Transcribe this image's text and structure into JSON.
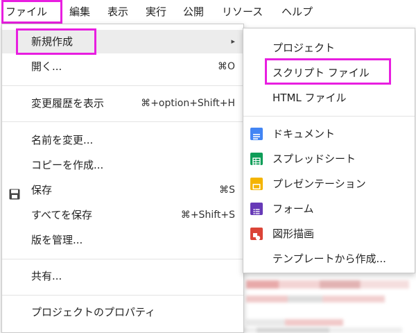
{
  "menubar": {
    "items": [
      "ファイル",
      "編集",
      "表示",
      "実行",
      "公開",
      "リソース",
      "ヘルプ"
    ]
  },
  "file_menu": {
    "items": [
      {
        "label": "新規作成",
        "shortcut": "▸"
      },
      {
        "label": "開く...",
        "shortcut": "⌘O"
      },
      {
        "label": "変更履歴を表示",
        "shortcut": "⌘+option+Shift+H"
      },
      {
        "label": "名前を変更...",
        "shortcut": ""
      },
      {
        "label": "コピーを作成...",
        "shortcut": ""
      },
      {
        "label": "保存",
        "shortcut": "⌘S"
      },
      {
        "label": "すべてを保存",
        "shortcut": "⌘+Shift+S"
      },
      {
        "label": "版を管理...",
        "shortcut": ""
      },
      {
        "label": "共有...",
        "shortcut": ""
      },
      {
        "label": "プロジェクトのプロパティ",
        "shortcut": ""
      }
    ]
  },
  "new_submenu": {
    "items": [
      {
        "label": "プロジェクト",
        "icon": "none"
      },
      {
        "label": "スクリプト ファイル",
        "icon": "none"
      },
      {
        "label": "HTML ファイル",
        "icon": "none"
      },
      {
        "label": "ドキュメント",
        "icon": "docs-icon",
        "color": "#4285f4"
      },
      {
        "label": "スプレッドシート",
        "icon": "sheets-icon",
        "color": "#0f9d58"
      },
      {
        "label": "プレゼンテーション",
        "icon": "slides-icon",
        "color": "#f4b400"
      },
      {
        "label": "フォーム",
        "icon": "forms-icon",
        "color": "#673ab7"
      },
      {
        "label": "図形描画",
        "icon": "drawings-icon",
        "color": "#db4437"
      },
      {
        "label": "テンプレートから作成...",
        "icon": "none"
      }
    ]
  },
  "colors": {
    "highlight": "#e81ee0",
    "active_row": "#ececec"
  }
}
